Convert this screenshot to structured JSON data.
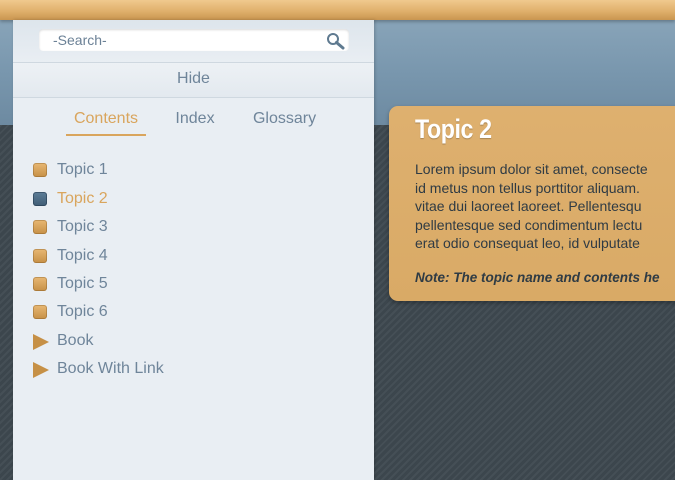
{
  "search": {
    "placeholder": "-Search-",
    "value": ""
  },
  "panel": {
    "hide_label": "Hide",
    "tabs": [
      {
        "label": "Contents",
        "active": true
      },
      {
        "label": "Index",
        "active": false
      },
      {
        "label": "Glossary",
        "active": false
      }
    ],
    "toc": [
      {
        "label": "Topic 1",
        "type": "page",
        "icon": "page-icon",
        "active": false
      },
      {
        "label": "Topic 2",
        "type": "page",
        "icon": "page-icon",
        "active": true
      },
      {
        "label": "Topic 3",
        "type": "page",
        "icon": "page-icon",
        "active": false
      },
      {
        "label": "Topic 4",
        "type": "page",
        "icon": "page-icon",
        "active": false
      },
      {
        "label": "Topic 5",
        "type": "page",
        "icon": "page-icon",
        "active": false
      },
      {
        "label": "Topic 6",
        "type": "page",
        "icon": "page-icon",
        "active": false
      },
      {
        "label": "Book",
        "type": "book",
        "icon": "book-icon",
        "active": false
      },
      {
        "label": "Book With Link",
        "type": "book",
        "icon": "book-icon",
        "active": false
      }
    ]
  },
  "topic": {
    "title": "Topic 2",
    "body_lines": [
      "Lorem ipsum dolor sit amet, consecte",
      "id metus non tellus porttitor aliquam.",
      "vitae dui laoreet laoreet. Pellentesqu",
      "pellentesque sed condimentum lectu",
      "erat odio consequat leo, id vulputate"
    ],
    "note": "Note: The topic name and contents he"
  },
  "colors": {
    "accent": "#d9a55d",
    "active_icon": "#4a6882",
    "text_muted": "#6f859a",
    "card_bg": "#dcad6b"
  }
}
